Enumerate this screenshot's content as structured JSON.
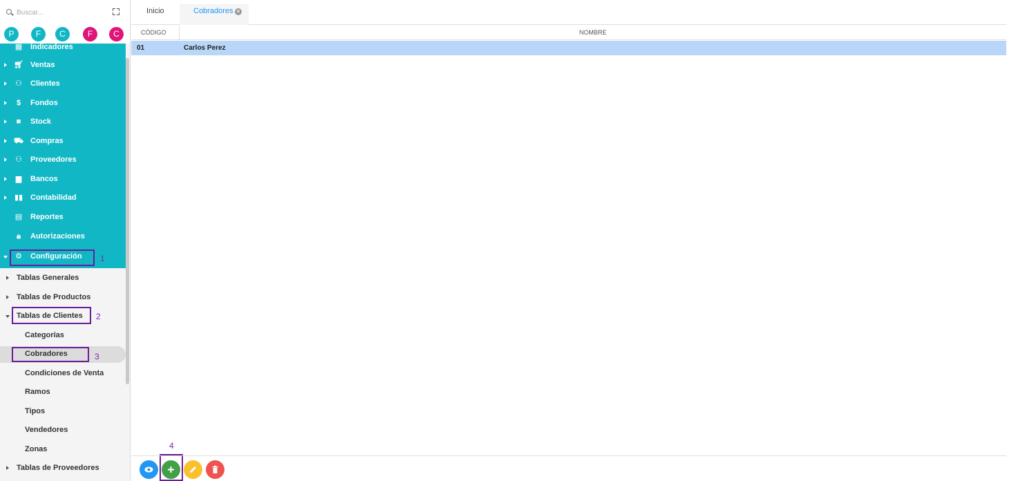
{
  "search": {
    "placeholder": "Buscar..."
  },
  "quick_access": [
    {
      "letter": "P",
      "color": "#11b7c5"
    },
    {
      "letter": "F",
      "color": "#11b7c5"
    },
    {
      "letter": "C",
      "color": "#11b7c5"
    },
    {
      "letter": "F",
      "color": "#e0157a"
    },
    {
      "letter": "C",
      "color": "#e0157a"
    }
  ],
  "sidebar": {
    "partial_item": "Indicadores",
    "items": [
      {
        "label": "Ventas",
        "icon": "cart-icon"
      },
      {
        "label": "Clientes",
        "icon": "people-icon"
      },
      {
        "label": "Fondos",
        "icon": "dollar-icon"
      },
      {
        "label": "Stock",
        "icon": "box-icon"
      },
      {
        "label": "Compras",
        "icon": "purchase-cart-icon"
      },
      {
        "label": "Proveedores",
        "icon": "people-icon"
      },
      {
        "label": "Bancos",
        "icon": "briefcase-icon"
      },
      {
        "label": "Contabilidad",
        "icon": "ledger-icon"
      },
      {
        "label": "Reportes",
        "icon": "report-icon"
      },
      {
        "label": "Autorizaciones",
        "icon": "lock-icon"
      },
      {
        "label": "Configuración",
        "icon": "gears-icon"
      }
    ],
    "sub_items": [
      {
        "label": "Tablas Generales"
      },
      {
        "label": "Tablas de Productos"
      },
      {
        "label": "Tablas de Clientes"
      },
      {
        "label": "Categorías"
      },
      {
        "label": "Cobradores"
      },
      {
        "label": "Condiciones de Venta"
      },
      {
        "label": "Ramos"
      },
      {
        "label": "Tipos"
      },
      {
        "label": "Vendedores"
      },
      {
        "label": "Zonas"
      },
      {
        "label": "Tablas de Proveedores"
      }
    ]
  },
  "annotations": [
    "1",
    "2",
    "3",
    "4"
  ],
  "tabs": [
    {
      "label": "Inicio"
    },
    {
      "label": "Cobradores"
    }
  ],
  "grid": {
    "columns": [
      "CÓDIGO",
      "NOMBRE"
    ],
    "rows": [
      {
        "code": "01",
        "name": "Carlos Perez"
      }
    ]
  },
  "actions": [
    {
      "name": "view",
      "icon": "eye-icon",
      "color": "#2196f3"
    },
    {
      "name": "add",
      "icon": "plus-icon",
      "color": "#43a047"
    },
    {
      "name": "edit",
      "icon": "pencil-icon",
      "color": "#fbc02d"
    },
    {
      "name": "delete",
      "icon": "trash-icon",
      "color": "#ef5350"
    }
  ]
}
